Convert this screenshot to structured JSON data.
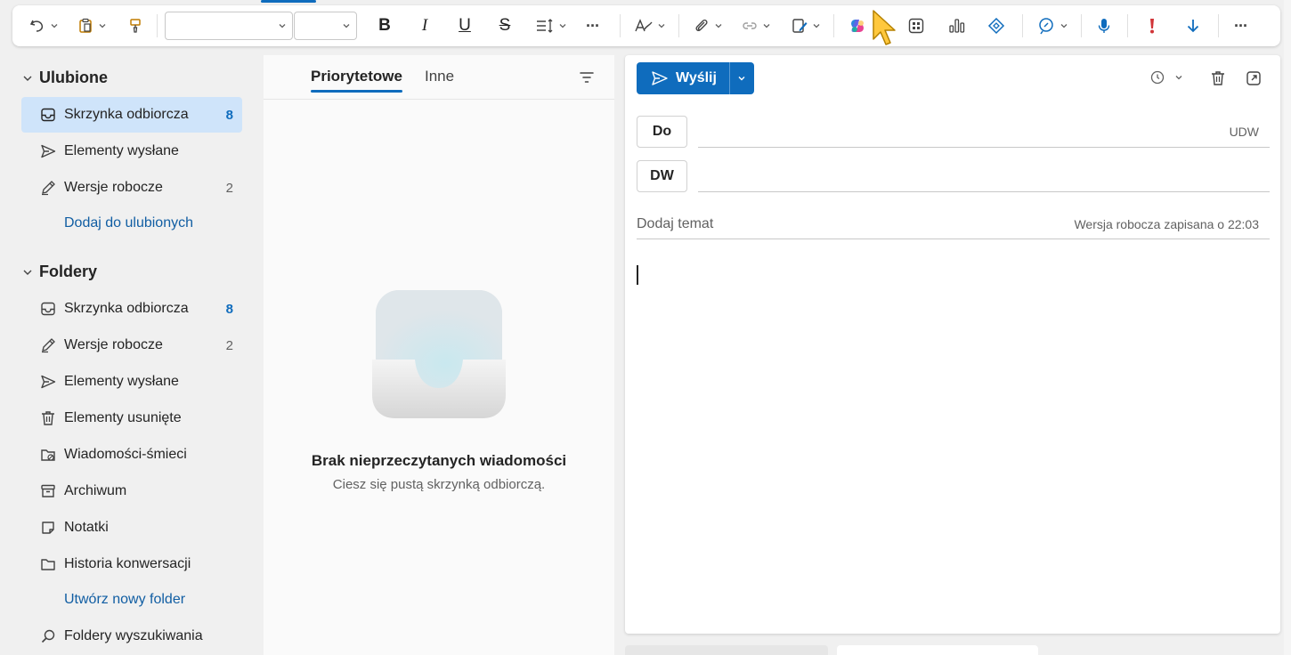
{
  "toolbar": {
    "bold_glyph": "B",
    "italic_glyph": "I",
    "underline_glyph": "U",
    "strike_glyph": "S",
    "more_glyph": "···",
    "more2_glyph": "···",
    "icons": [
      "undo-icon",
      "clipboard-icon",
      "format-painter-icon",
      "bold-icon",
      "italic-icon",
      "underline-icon",
      "strikethrough-icon",
      "paragraph-spacing-icon",
      "more-icon",
      "styles-icon",
      "attach-icon",
      "link-icon",
      "signature-icon",
      "copilot-icon",
      "apps-icon",
      "chart-icon",
      "loop-icon",
      "editor-icon",
      "dictate-icon",
      "importance-high-icon",
      "importance-low-icon",
      "more-options-icon"
    ]
  },
  "sidebar": {
    "favorites_header": "Ulubione",
    "folders_header": "Foldery",
    "favorites": [
      {
        "label": "Skrzynka odbiorcza",
        "count": "8",
        "icon": "inbox-icon"
      },
      {
        "label": "Elementy wysłane",
        "count": "",
        "icon": "send-icon"
      },
      {
        "label": "Wersje robocze",
        "count": "2",
        "icon": "draft-icon"
      }
    ],
    "add_favorite": "Dodaj do ulubionych",
    "folders": [
      {
        "label": "Skrzynka odbiorcza",
        "count": "8",
        "icon": "inbox-icon"
      },
      {
        "label": "Wersje robocze",
        "count": "2",
        "icon": "draft-icon"
      },
      {
        "label": "Elementy wysłane",
        "count": "",
        "icon": "send-icon"
      },
      {
        "label": "Elementy usunięte",
        "count": "",
        "icon": "trash-icon"
      },
      {
        "label": "Wiadomości-śmieci",
        "count": "",
        "icon": "junk-icon"
      },
      {
        "label": "Archiwum",
        "count": "",
        "icon": "archive-icon"
      },
      {
        "label": "Notatki",
        "count": "",
        "icon": "note-icon"
      },
      {
        "label": "Historia konwersacji",
        "count": "",
        "icon": "folder-icon"
      }
    ],
    "new_folder": "Utwórz nowy folder",
    "search_folders": "Foldery wyszukiwania"
  },
  "list": {
    "tab_focused": "Priorytetowe",
    "tab_other": "Inne",
    "empty_title": "Brak nieprzeczytanych wiadomości",
    "empty_subtitle": "Ciesz się pustą skrzynką odbiorczą."
  },
  "compose": {
    "send_label": "Wyślij",
    "to_label": "Do",
    "cc_label": "DW",
    "bcc_label": "UDW",
    "subject_placeholder": "Dodaj temat",
    "draft_status": "Wersja robocza zapisana o 22:03"
  },
  "colors": {
    "accent": "#0f6cbd",
    "selected_bg": "#cfe4fa",
    "link": "#115ea3"
  }
}
